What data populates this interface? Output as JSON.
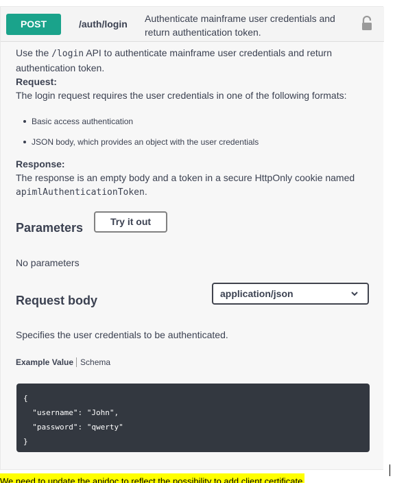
{
  "operation": {
    "method": "POST",
    "path": "/auth/login",
    "summary": "Authenticate mainframe user credentials and return authentication token.",
    "icon": "lock-icon"
  },
  "description": {
    "intro_pre": "Use the ",
    "intro_code": "/login",
    "intro_post": " API to authenticate mainframe user credentials and return authentication token.",
    "request_heading": "Request:",
    "request_text": "The login request requires the user credentials in one of the following formats:",
    "bullets": [
      "Basic access authentication",
      "JSON body, which provides an object with the user credentials"
    ],
    "response_heading": "Response:",
    "response_text": "The response is an empty body and a token in a secure HttpOnly cookie named",
    "response_code": "apimlAuthenticationToken",
    "response_end": "."
  },
  "parameters": {
    "title": "Parameters",
    "try_label": "Try it out",
    "empty_text": "No parameters"
  },
  "request_body": {
    "title": "Request body",
    "content_type": "application/json",
    "description": "Specifies the user credentials to be authenticated.",
    "tabs": [
      "Example Value",
      "Schema"
    ],
    "example": "{\n  \"username\": \"John\",\n  \"password\": \"qwerty\"\n}"
  },
  "note": {
    "text": "We need to update the apidoc to reflect the possibility to add client certificate"
  }
}
